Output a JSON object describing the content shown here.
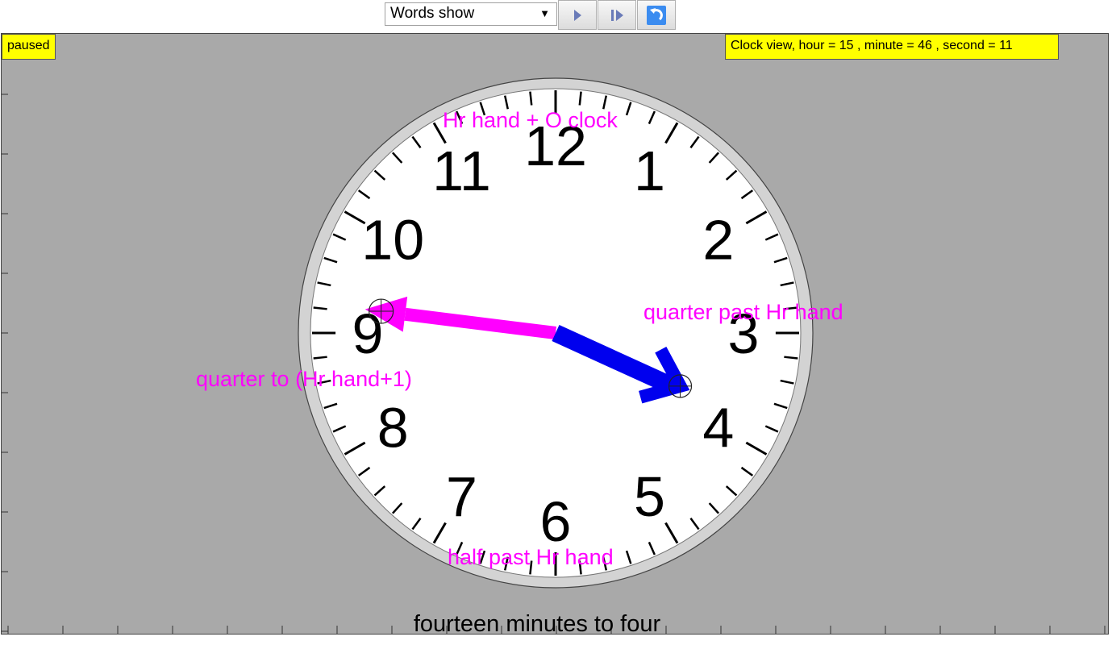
{
  "toolbar": {
    "mode_select": {
      "value": "Words show",
      "caret": "▼"
    },
    "buttons": [
      {
        "name": "play-icon"
      },
      {
        "name": "step-icon"
      },
      {
        "name": "reset-icon"
      }
    ]
  },
  "status": {
    "state": "paused",
    "info": "Clock view, hour = 15 , minute = 46 , second = 11"
  },
  "clock": {
    "hour": 15,
    "minute": 46,
    "second": 11,
    "numbers": [
      "12",
      "1",
      "2",
      "3",
      "4",
      "5",
      "6",
      "7",
      "8",
      "9",
      "10",
      "11"
    ],
    "hints": {
      "top": "Hr hand + O clock",
      "right": "quarter past Hr hand",
      "bottom": "half past Hr hand",
      "left": "quarter to (Hr hand+1)"
    },
    "hour_hand_color": "#0000ee",
    "minute_hand_color": "#ff00ff",
    "hint_color": "#ff00ff"
  },
  "words": "fourteen minutes to four"
}
